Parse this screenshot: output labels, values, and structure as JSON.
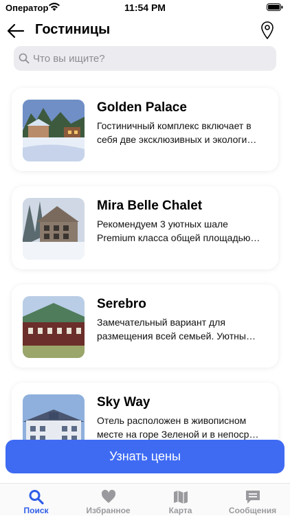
{
  "status": {
    "carrier": "Оператор",
    "time": "11:54 PM"
  },
  "header": {
    "title": "Гостиницы"
  },
  "search": {
    "placeholder": "Что вы ищите?"
  },
  "hotels": [
    {
      "title": "Golden Palace",
      "description": "Гостиничный комплекс включает в себя две эксклюзивных и экологи…"
    },
    {
      "title": "Mira Belle Chalet",
      "description": "Рекомендуем 3 уютных шале Premium класса общей площадью…"
    },
    {
      "title": "Serebro",
      "description": "Замечательный вариант для размещения всей семьей. Уютны…"
    },
    {
      "title": "Sky Way",
      "description": "Отель расположен в живописном месте на горе Зеленой и в непоср…"
    }
  ],
  "cta": {
    "label": "Узнать цены"
  },
  "tabs": [
    {
      "label": "Поиск",
      "icon": "search-icon",
      "active": true
    },
    {
      "label": "Избранное",
      "icon": "heart-icon",
      "active": false
    },
    {
      "label": "Карта",
      "icon": "map-icon",
      "active": false
    },
    {
      "label": "Сообщения",
      "icon": "message-icon",
      "active": false
    }
  ],
  "colors": {
    "accent": "#3f6bf3",
    "tab_active": "#2e5de8",
    "tab_inactive": "#9a9a9e"
  }
}
